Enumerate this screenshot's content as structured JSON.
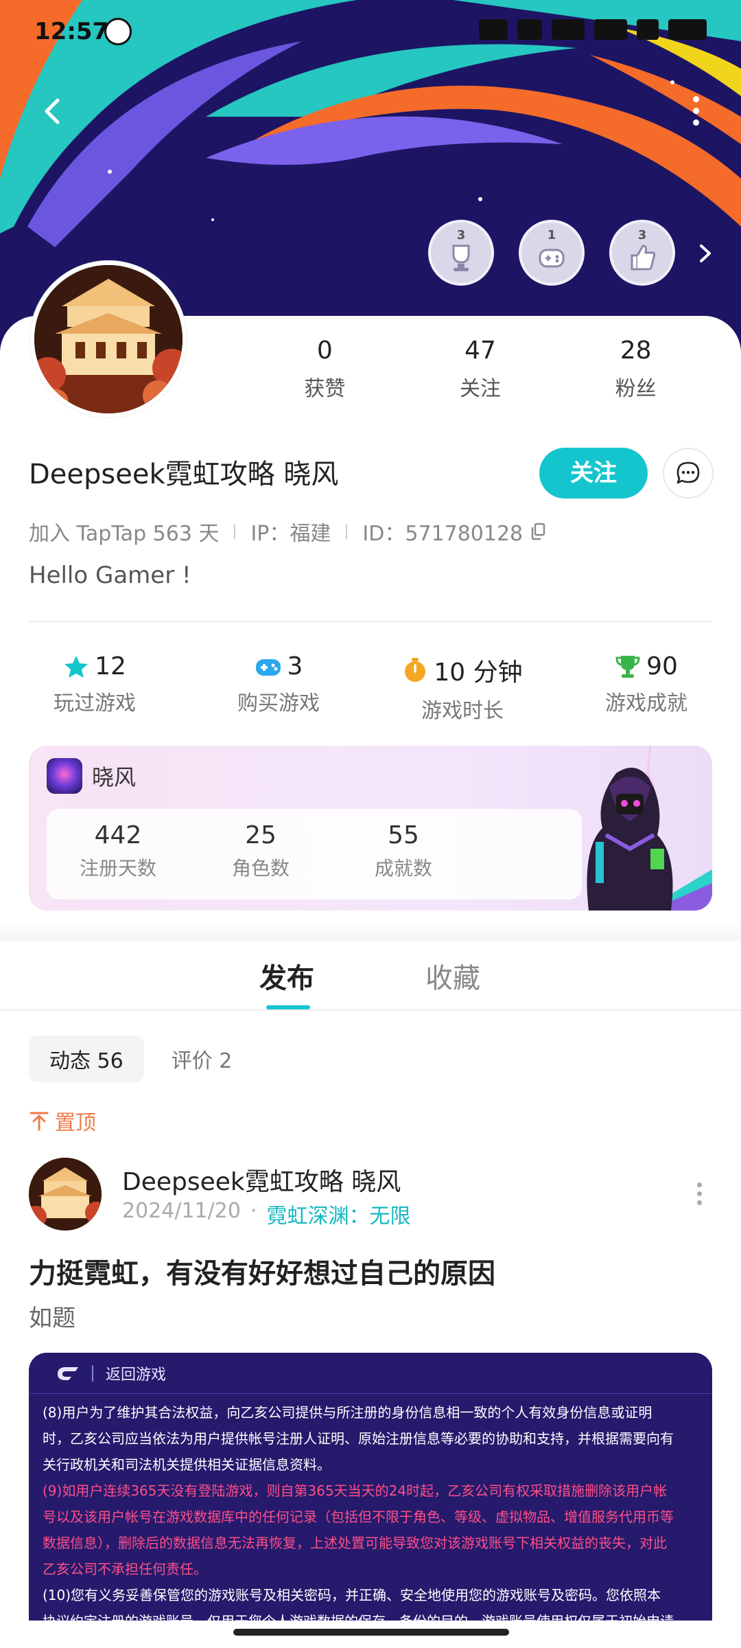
{
  "status_bar": {
    "time": "12:57"
  },
  "header": {
    "badges": [
      {
        "count": "3"
      },
      {
        "count": "1"
      },
      {
        "count": "3"
      }
    ]
  },
  "profile": {
    "stats": [
      {
        "value": "0",
        "label": "获赞"
      },
      {
        "value": "47",
        "label": "关注"
      },
      {
        "value": "28",
        "label": "粉丝"
      }
    ],
    "name": "Deepseek霓虹攻略 晓风",
    "follow_label": "关注",
    "joined": "加入 TapTap 563 天",
    "ip": "IP：福建",
    "id": "ID：571780128",
    "bio": "Hello Gamer !"
  },
  "game_stats": [
    {
      "icon": "star-icon",
      "value": "12",
      "label": "玩过游戏",
      "color": "#15c5ce"
    },
    {
      "icon": "gamepad-icon",
      "value": "3",
      "label": "购买游戏",
      "color": "#2aa7ee"
    },
    {
      "icon": "stopwatch-icon",
      "value": "10 分钟",
      "label": "游戏时长",
      "color": "#f5a623"
    },
    {
      "icon": "trophy-icon",
      "value": "90",
      "label": "游戏成就",
      "color": "#3bb54a"
    }
  ],
  "game_card": {
    "name": "晓风",
    "stats": [
      {
        "value": "442",
        "label": "注册天数"
      },
      {
        "value": "25",
        "label": "角色数"
      },
      {
        "value": "55",
        "label": "成就数"
      }
    ]
  },
  "tabs": {
    "active": "发布",
    "inactive": "收藏"
  },
  "sub_tabs": {
    "active": "动态 56",
    "inactive": "评价 2"
  },
  "pinned_label": "置顶",
  "post": {
    "author": "Deepseek霓虹攻略 晓风",
    "date": "2024/11/20",
    "dot": "·",
    "game": "霓虹深渊：无限",
    "title": "力挺霓虹，有没有好好想过自己的原因",
    "body": "如题",
    "image": {
      "back_label": "返回游戏",
      "lines": [
        {
          "text": "(8)用户为了维护其合法权益，向乙亥公司提供与所注册的身份信息相一致的个人有效身份信息或证明",
          "color": "w"
        },
        {
          "text": "时，乙亥公司应当依法为用户提供帐号注册人证明、原始注册信息等必要的协助和支持，并根据需要向有",
          "color": "w"
        },
        {
          "text": "关行政机关和司法机关提供相关证据信息资料。",
          "color": "w"
        },
        {
          "text": "(9)如用户连续365天没有登陆游戏，则自第365天当天的24时起，乙亥公司有权采取措施删除该用户帐",
          "color": "r"
        },
        {
          "text": "号以及该用户帐号在游戏数据库中的任何记录（包括但不限于角色、等级、虚拟物品、增值服务代用币等",
          "color": "r"
        },
        {
          "text": "数据信息），删除后的数据信息无法再恢复，上述处置可能导致您对该游戏账号下相关权益的丧失，对此",
          "color": "r"
        },
        {
          "text": "乙亥公司不承担任何责任。",
          "color": "r"
        },
        {
          "text": "(10)您有义务妥善保管您的游戏账号及相关密码，并正确、安全地使用您的游戏账号及密码。您依照本",
          "color": "w"
        },
        {
          "text": "协议约定注册的游戏账号，仅用于您个人游戏数据的保存、备份的目的。游戏账号使用权仅属于初始申请",
          "color": "w"
        }
      ]
    }
  }
}
